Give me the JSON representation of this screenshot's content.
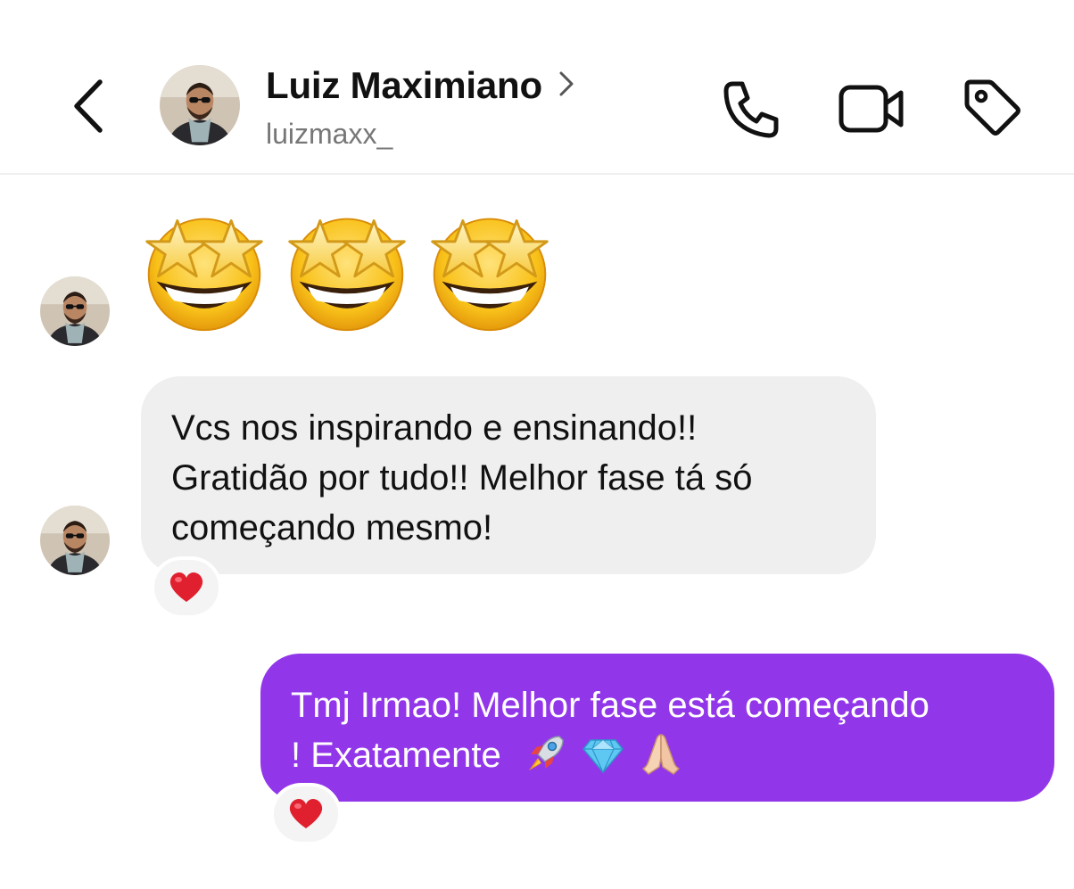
{
  "header": {
    "contact_name": "Luiz Maximiano",
    "username": "luizmaxx_",
    "icons": {
      "back": "chevron-left-icon",
      "chevron": "chevron-right-icon",
      "call": "phone-icon",
      "video": "video-camera-icon",
      "label": "tag-icon"
    }
  },
  "messages": [
    {
      "sender": "Luiz Maximiano",
      "type": "emoji",
      "emojis": [
        "star-struck-emoji",
        "star-struck-emoji",
        "star-struck-emoji"
      ]
    },
    {
      "sender": "Luiz Maximiano",
      "type": "text",
      "lines": [
        "Vcs nos inspirando e ensinando!!",
        "Gratidão por tudo!! Melhor fase tá só",
        "começando mesmo!"
      ],
      "reaction": "red-heart-emoji"
    },
    {
      "sender": "me",
      "type": "text",
      "lines": [
        "Tmj Irmao! Melhor fase está começando",
        "! Exatamente"
      ],
      "trailing_emojis": [
        "rocket-emoji",
        "gem-emoji",
        "folded-hands-emoji"
      ],
      "reaction": "red-heart-emoji"
    }
  ],
  "colors": {
    "outgoing_bubble": "#9236ea",
    "incoming_bubble": "#efefef",
    "reaction_heart": "#e0202e"
  }
}
